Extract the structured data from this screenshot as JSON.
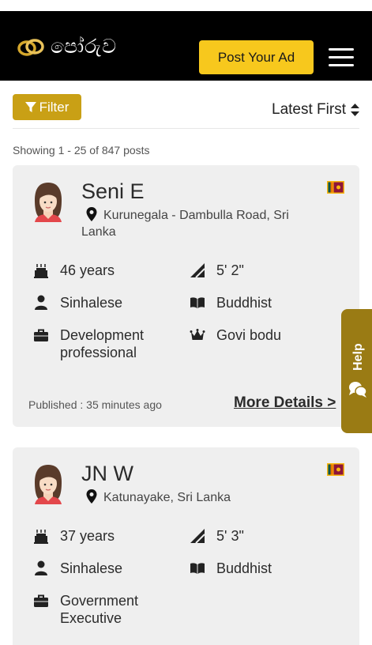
{
  "navbar": {
    "logo_text": "පෝරුව",
    "post_ad_label": "Post Your Ad",
    "menu_icon": "hamburger-icon"
  },
  "toolbar": {
    "filter_label": "Filter",
    "sort_label": "Latest First"
  },
  "results": {
    "showing_text": "Showing 1 - 25 of 847 posts"
  },
  "profiles": [
    {
      "name": "Seni E",
      "location": "Kurunegala - Dambulla Road, Sri Lanka",
      "age": "46 years",
      "height": "5' 2\"",
      "ethnicity": "Sinhalese",
      "religion": "Buddhist",
      "profession": "Development professional",
      "caste": "Govi bodu",
      "published": "Published : 35 minutes ago",
      "more_label": "More Details >"
    },
    {
      "name": "JN W",
      "location": "Katunayake, Sri Lanka",
      "age": "37 years",
      "height": "5' 3\"",
      "ethnicity": "Sinhalese",
      "religion": "Buddhist",
      "profession": "Government Executive"
    }
  ],
  "help": {
    "label": "Help"
  },
  "colors": {
    "navbar": "#000000",
    "post_button": "#f7c81d",
    "filter_button": "#c9a015",
    "help_tab": "#9a7b14",
    "card": "#efefef"
  }
}
